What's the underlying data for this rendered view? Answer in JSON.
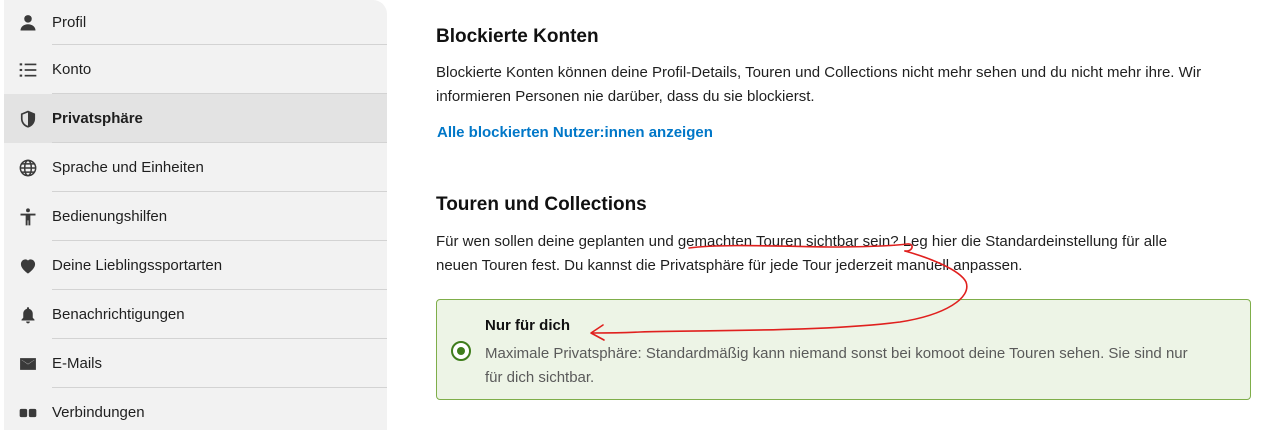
{
  "sidebar": {
    "items": [
      {
        "label": "Profil",
        "icon": "person-icon"
      },
      {
        "label": "Konto",
        "icon": "list-icon"
      },
      {
        "label": "Privatsphäre",
        "icon": "shield-icon",
        "active": true
      },
      {
        "label": "Sprache und Einheiten",
        "icon": "globe-icon"
      },
      {
        "label": "Bedienungshilfen",
        "icon": "accessibility-icon"
      },
      {
        "label": "Deine Lieblingssportarten",
        "icon": "heart-icon"
      },
      {
        "label": "Benachrichtigungen",
        "icon": "bell-icon"
      },
      {
        "label": "E-Mails",
        "icon": "mail-icon"
      },
      {
        "label": "Verbindungen",
        "icon": "link-icon"
      }
    ]
  },
  "blocked": {
    "title": "Blockierte Konten",
    "line1": "Blockierte Konten können deine Profil-Details, Touren und Collections nicht mehr sehen und du nicht mehr ihre. Wir",
    "line2": "informieren Personen nie darüber, dass du sie blockierst.",
    "link": "Alle blockierten Nutzer:innen anzeigen"
  },
  "tours": {
    "title": "Touren und Collections",
    "line1": "Für wen sollen deine geplanten und gemachten Touren sichtbar sein? Leg hier die Standardeinstellung für alle",
    "line2": "neuen Touren fest. Du kannst die Privatsphäre für jede Tour jederzeit manuell anpassen.",
    "option": {
      "title": "Nur für dich",
      "desc_line1": "Maximale Privatsphäre: Standardmäßig kann niemand sonst bei komoot deine Touren sehen. Sie sind nur",
      "desc_line2": "für dich sichtbar.",
      "selected": true
    }
  },
  "colors": {
    "accent_link": "#0077c8",
    "option_border": "#7fae4a",
    "option_bg": "#edf4e6",
    "annotation_red": "#e0201e"
  }
}
